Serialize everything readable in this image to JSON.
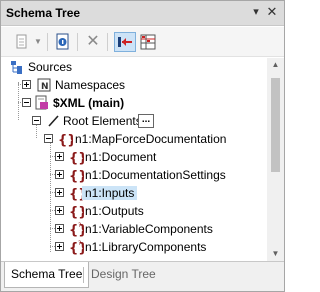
{
  "window": {
    "title": "Schema Tree",
    "pin_icon": "pin-icon",
    "close_icon": "close-icon"
  },
  "toolbar": {
    "items": [
      {
        "icon": "add-root-icon"
      },
      {
        "icon": "dropdown-arrow-icon"
      },
      {
        "icon": "document-info-icon"
      },
      {
        "icon": "delete-icon"
      },
      {
        "icon": "sync-tree-icon",
        "active": true
      },
      {
        "icon": "grid-settings-icon"
      }
    ]
  },
  "tree": {
    "sources_label": "Sources",
    "namespaces_label": "Namespaces",
    "xml_label": "$XML (main)",
    "root_elements_label": "Root Elements",
    "root_elements_button": "...",
    "mapforce_label": "n1:MapForceDocumentation",
    "children": [
      {
        "label": "n1:Document"
      },
      {
        "label": "n1:DocumentationSettings"
      },
      {
        "label": "n1:Inputs",
        "selected": true
      },
      {
        "label": "n1:Outputs"
      },
      {
        "label": "n1:VariableComponents"
      },
      {
        "label": "n1:LibraryComponents"
      }
    ]
  },
  "tabs": [
    {
      "label": "Schema Tree",
      "active": true
    },
    {
      "label": "Design Tree",
      "active": false
    }
  ],
  "colors": {
    "selection": "#cce4f7",
    "element_icon": "#8b1a1a",
    "titlebar": "#dcdcdc"
  }
}
